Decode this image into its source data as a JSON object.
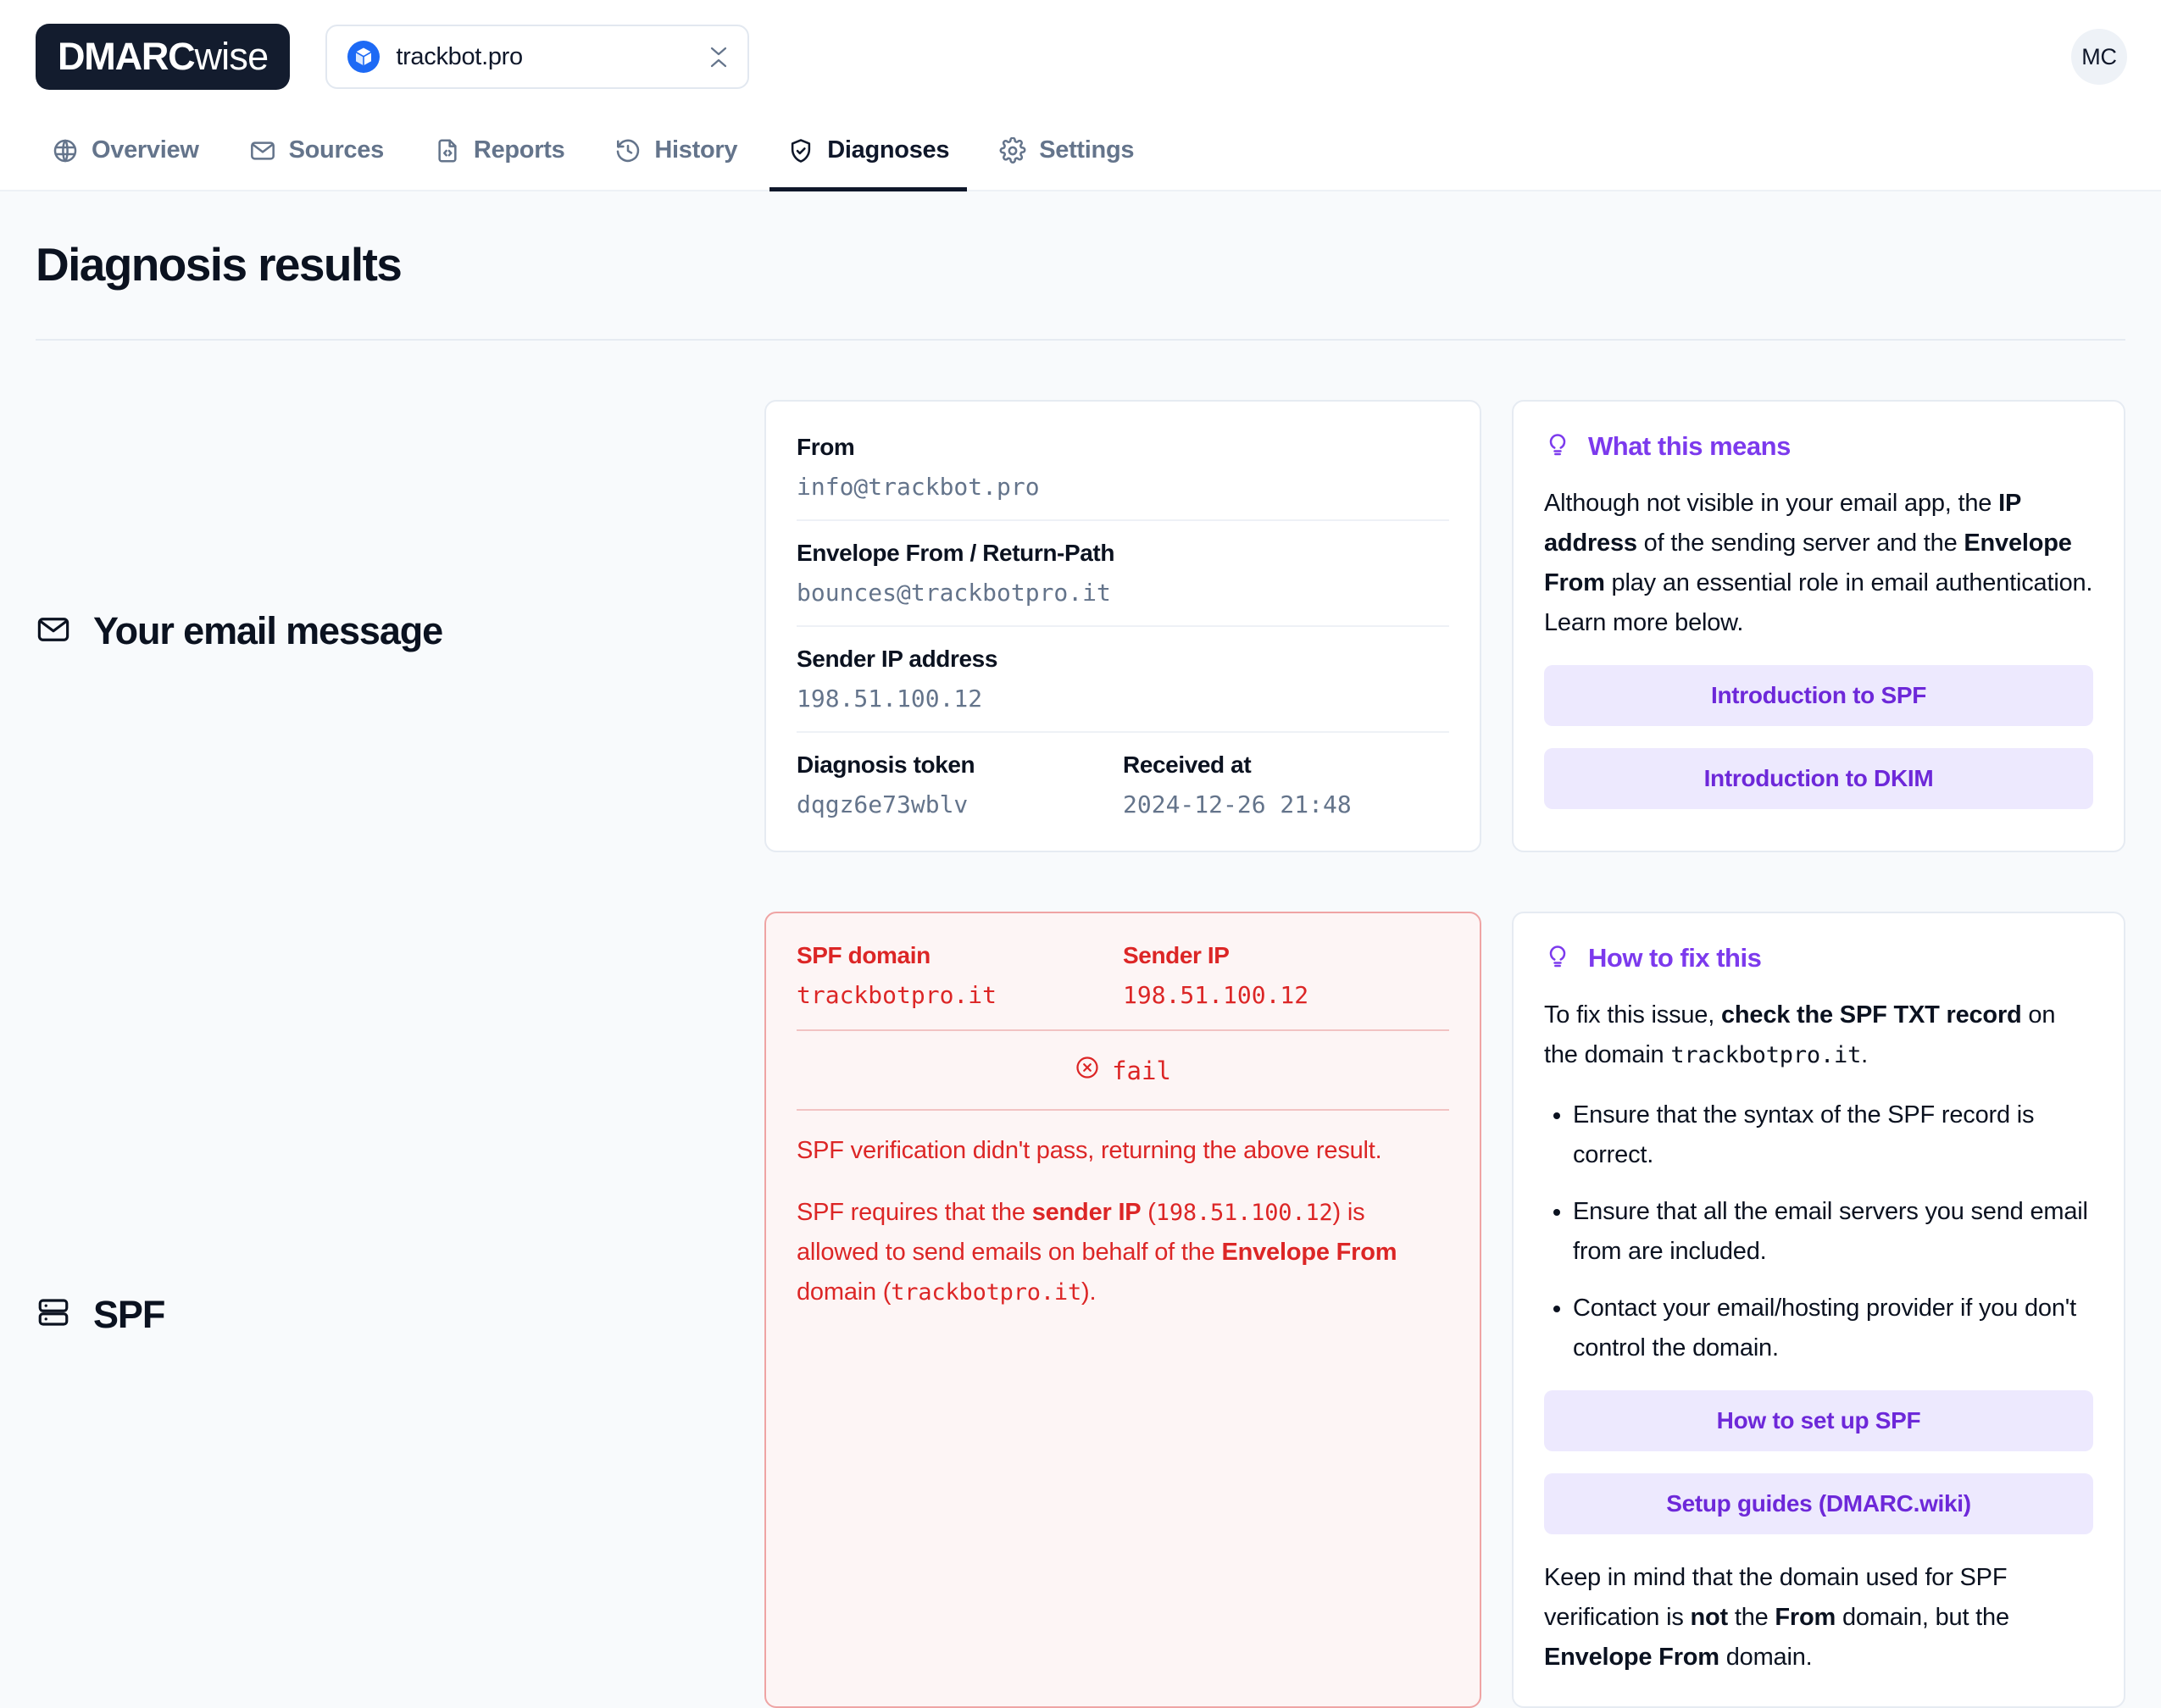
{
  "brand": {
    "strong": "DMARC",
    "light": "wise"
  },
  "domain_selector": {
    "value": "trackbot.pro",
    "icon": "cube-icon"
  },
  "user": {
    "initials": "MC"
  },
  "nav": {
    "items": [
      {
        "label": "Overview",
        "icon": "globe-icon",
        "active": false
      },
      {
        "label": "Sources",
        "icon": "envelope-icon",
        "active": false
      },
      {
        "label": "Reports",
        "icon": "file-code-icon",
        "active": false
      },
      {
        "label": "History",
        "icon": "clock-rewind-icon",
        "active": false
      },
      {
        "label": "Diagnoses",
        "icon": "shield-check-icon",
        "active": true
      },
      {
        "label": "Settings",
        "icon": "gear-icon",
        "active": false
      }
    ]
  },
  "page": {
    "title": "Diagnosis results"
  },
  "message_section": {
    "title": "Your email message",
    "icon": "envelope-icon",
    "fields": {
      "from_label": "From",
      "from_value": "info@trackbot.pro",
      "envelope_label": "Envelope From / Return-Path",
      "envelope_value": "bounces@trackbotpro.it",
      "ip_label": "Sender IP address",
      "ip_value": "198.51.100.12",
      "token_label": "Diagnosis token",
      "token_value": "dqgz6e73wblv",
      "received_label": "Received at",
      "received_value": "2024-12-26 21:48"
    },
    "info": {
      "icon": "lightbulb-icon",
      "title": "What this means",
      "text_1": "Although not visible in your email app, the ",
      "bold_1": "IP address",
      "text_2": " of the sending server and the ",
      "bold_2": "Envelope From",
      "text_3": " play an essential role in email authentication. Learn more below.",
      "button_spf": "Introduction to SPF",
      "button_dkim": "Introduction to DKIM"
    }
  },
  "spf_section": {
    "title": "SPF",
    "icon": "server-stack-icon",
    "result": {
      "domain_label": "SPF domain",
      "domain_value": "trackbotpro.it",
      "sender_ip_label": "Sender IP",
      "sender_ip_value": "198.51.100.12",
      "status_icon": "x-circle-icon",
      "status": "fail",
      "para_1": "SPF verification didn't pass, returning the above result.",
      "p2_text_1": "SPF requires that the ",
      "p2_bold_1": "sender IP",
      "p2_text_2": " (",
      "p2_mono_1": "198.51.100.12",
      "p2_text_3": ") is allowed to send emails on behalf of the ",
      "p2_bold_2": "Envelope From",
      "p2_text_4": " domain (",
      "p2_mono_2": "trackbotpro.it",
      "p2_text_5": ")."
    },
    "info": {
      "icon": "lightbulb-icon",
      "title": "How to fix this",
      "intro_text_1": "To fix this issue, ",
      "intro_bold_1": "check the SPF TXT record",
      "intro_text_2": " on the domain ",
      "intro_mono_1": "trackbotpro.it",
      "intro_text_3": ".",
      "bullets": [
        "Ensure that the syntax of the SPF record is correct.",
        "Ensure that all the email servers you send email from are included.",
        "Contact your email/hosting provider if you don't control the domain."
      ],
      "button_setup": "How to set up SPF",
      "button_guides": "Setup guides (DMARC.wiki)",
      "outro_text_1": "Keep in mind that the domain used for SPF verification is ",
      "outro_bold_1": "not",
      "outro_text_2": " the ",
      "outro_bold_2": "From",
      "outro_text_3": " domain, but the ",
      "outro_bold_3": "Envelope From",
      "outro_text_4": " domain."
    }
  },
  "colors": {
    "accent": "#7C3AED",
    "accent_bg": "#EDE9FE",
    "danger": "#DC2626",
    "danger_bg": "#FDF5F5",
    "page_bg": "#F8FAFC",
    "ink": "#0B1220",
    "muted": "#64748B",
    "brand_dark": "#131C2E",
    "domain_blue": "#1D6AF5"
  }
}
